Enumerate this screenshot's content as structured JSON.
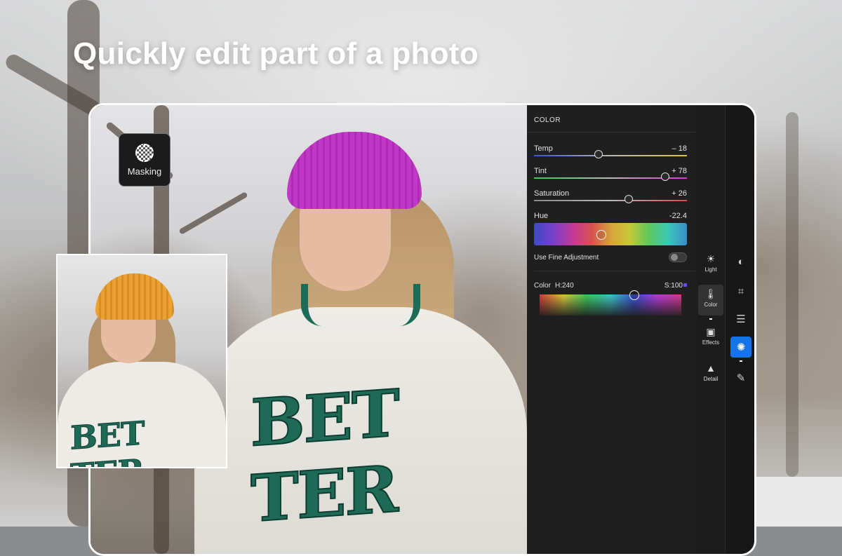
{
  "headline": "Quickly edit part of a photo",
  "masking": {
    "label": "Masking",
    "icon": "masking-icon"
  },
  "photo": {
    "jacket_text": "BET TER",
    "inset_jacket_text": "BET TER",
    "beanie_color": "#c238c6",
    "inset_beanie_color": "#eba233"
  },
  "panel": {
    "title": "COLOR",
    "sliders": [
      {
        "label": "Temp",
        "value": "– 18",
        "position": 0.42
      },
      {
        "label": "Tint",
        "value": "+ 78",
        "position": 0.86
      },
      {
        "label": "Saturation",
        "value": "+ 26",
        "position": 0.62
      }
    ],
    "hue": {
      "label": "Hue",
      "value": "-22.4",
      "position": 0.44
    },
    "fine_adjustment": {
      "label": "Use Fine Adjustment",
      "enabled": false
    },
    "color": {
      "label": "Color",
      "h": "H:240",
      "s": "S:100",
      "accent": "#6b46ff",
      "position": 0.67
    }
  },
  "tools": [
    {
      "label": "Light",
      "icon": "sun-icon"
    },
    {
      "label": "Color",
      "icon": "thermometer-icon",
      "active": true
    },
    {
      "label": "Effects",
      "icon": "vignette-icon"
    },
    {
      "label": "Detail",
      "icon": "triangle-icon"
    }
  ],
  "rail": [
    {
      "icon": "presets-icon"
    },
    {
      "icon": "crop-rotate-icon"
    },
    {
      "icon": "sliders-icon"
    },
    {
      "icon": "masking-icon",
      "active": true
    },
    {
      "icon": "healing-bandage-icon"
    }
  ],
  "colors": {
    "accent": "#1473e6",
    "panel_bg": "#1f1f1f"
  }
}
